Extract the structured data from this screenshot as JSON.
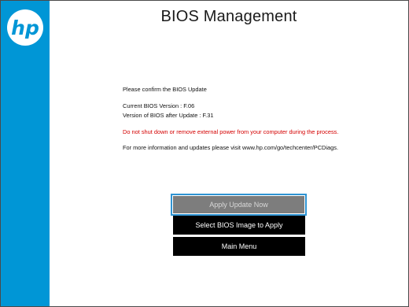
{
  "brand": {
    "logo_text": "hp",
    "color": "#0096d6"
  },
  "header": {
    "title": "BIOS Management"
  },
  "message": {
    "confirm": "Please confirm the BIOS Update",
    "current_version": "Current BIOS Version : F.06",
    "after_version": "Version of BIOS after Update : F.31",
    "warning": "Do not shut down or remove external power from your computer during the process.",
    "info": "For more information and updates please visit www.hp.com/go/techcenter/PCDiags."
  },
  "buttons": {
    "apply": "Apply Update Now",
    "select_image": "Select BIOS  Image to Apply",
    "main_menu": "Main Menu"
  },
  "colors": {
    "warning": "#d40000",
    "focus_border": "#2f94d3"
  }
}
